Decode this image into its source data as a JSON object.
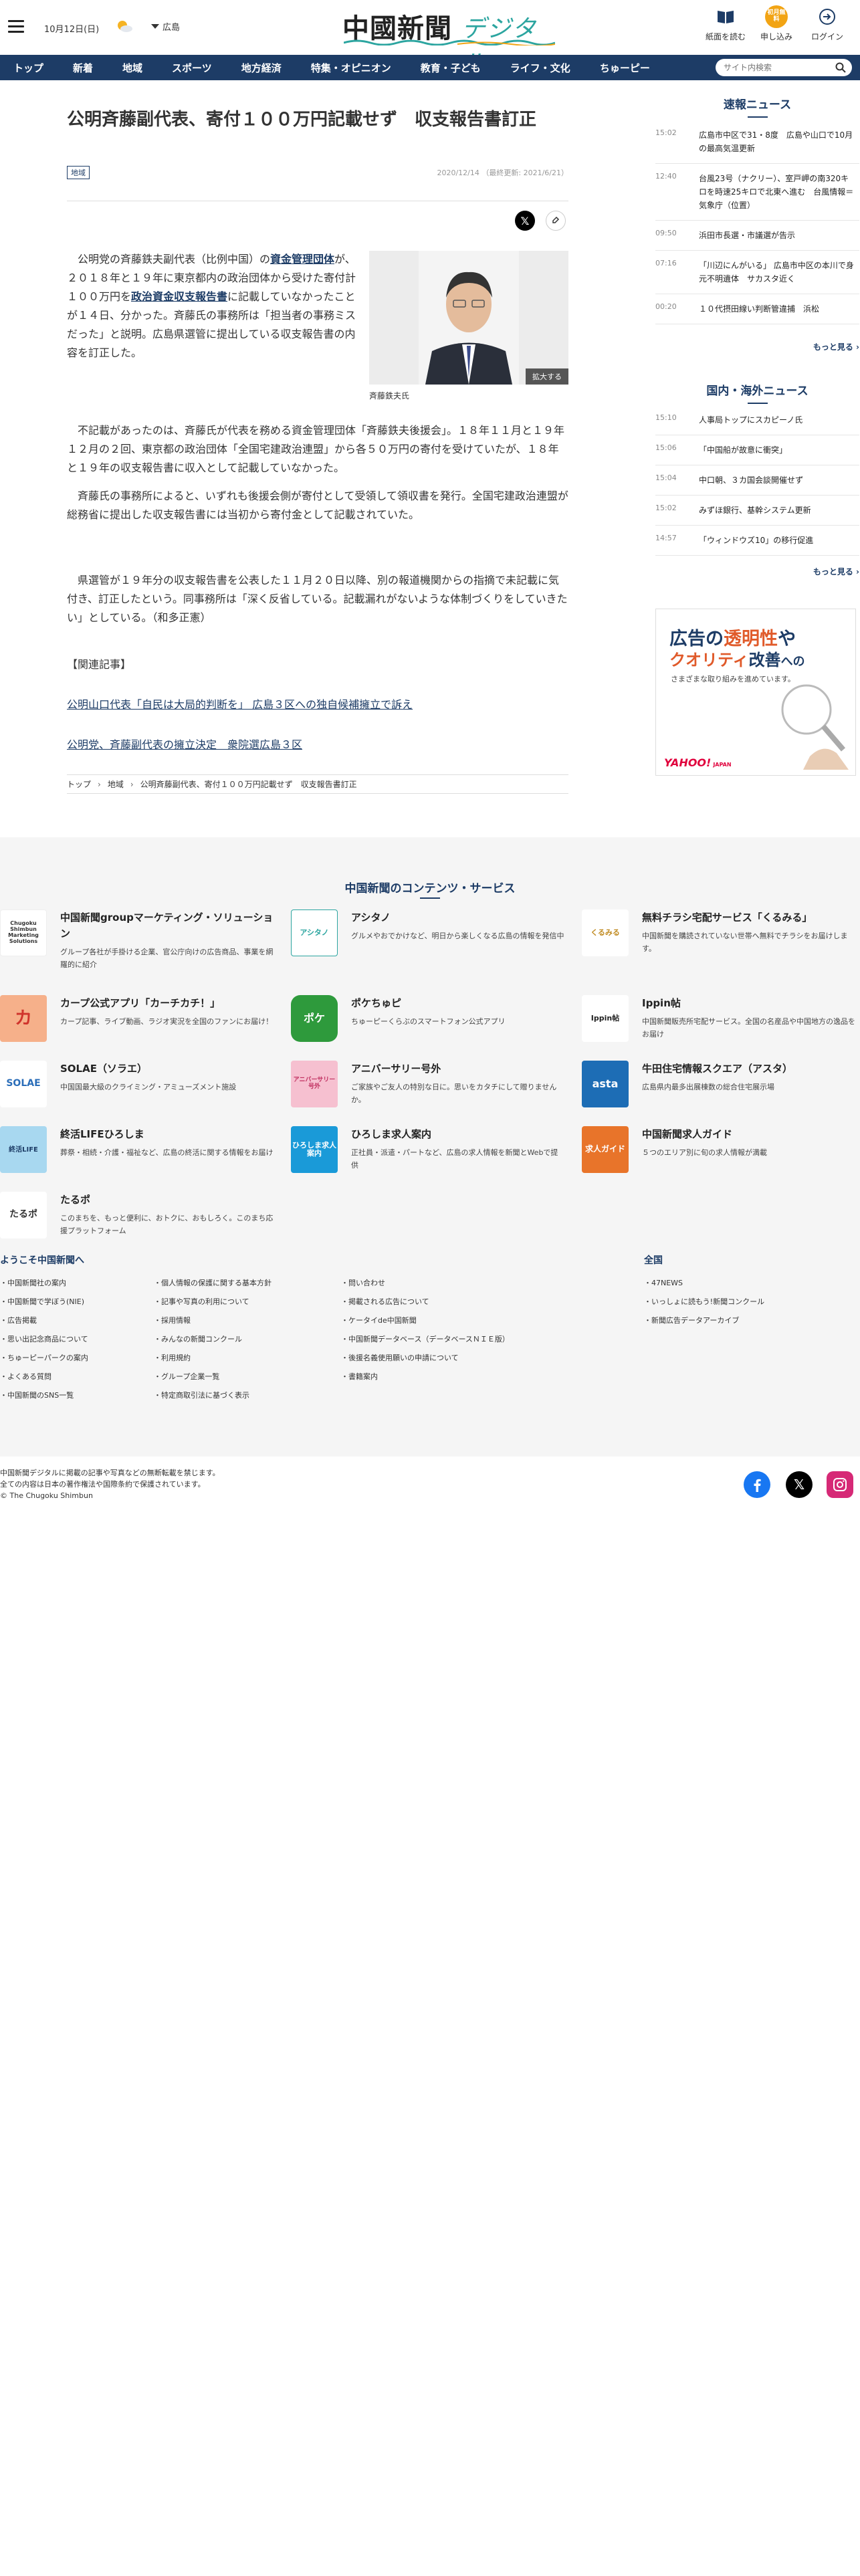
{
  "header": {
    "date": "10月12日(日)",
    "weather_icon": "sun-cloud-icon",
    "region": "広島",
    "logo_main": "中國新聞",
    "logo_sub": "デジタル",
    "buttons": [
      {
        "label": "紙面を読む",
        "icon": "book-icon"
      },
      {
        "label": "申し込み",
        "icon": "subscribe-badge",
        "badge": "初月無料"
      },
      {
        "label": "ログイン",
        "icon": "login-icon"
      }
    ]
  },
  "nav": {
    "items": [
      "トップ",
      "新着",
      "地域",
      "スポーツ",
      "地方経済",
      "特集・オピニオン",
      "教育・子ども",
      "ライフ・文化",
      "ちゅーピー"
    ],
    "search_placeholder": "サイト内検索"
  },
  "article": {
    "title": "公明斉藤副代表、寄付１００万円記載せず　収支報告書訂正",
    "category": "地域",
    "date": "2020/12/14",
    "updated": "（最終更新: 2021/6/21）",
    "p1": {
      "a": "公明党の斉藤鉄夫副代表（比例中国）の",
      "link1": "資金管理団体",
      "b": "が、２０１８年と１９年に東京都内の政治団体から受けた寄付計１００万円を",
      "link2": "政治資金収支報告書",
      "c": "に記載していなかったことが１４日、分かった。斉藤氏の事務所は「担当者の事務ミスだった」と説明。広島県選管に提出している収支報告書の内容を訂正した。"
    },
    "p2": "不記載があったのは、斉藤氏が代表を務める資金管理団体「斉藤鉄夫後援会」。１８年１１月と１９年１２月の２回、東京都の政治団体「全国宅建政治連盟」から各５０万円の寄付を受けていたが、１８年と１９年の収支報告書に収入として記載していなかった。",
    "p3": "斉藤氏の事務所によると、いずれも後援会側が寄付として受領して領収書を発行。全国宅建政治連盟が総務省に提出した収支報告書には当初から寄付金として記載されていた。",
    "p4": "県選管が１９年分の収支報告書を公表した１１月２０日以降、別の報道機関からの指摘で未記載に気付き、訂正したという。同事務所は「深く反省している。記載漏れがないような体制づくりをしていきたい」としている。（和多正憲）",
    "photo_caption": "斉藤鉄夫氏",
    "zoom_label": "拡大する",
    "related_heading": "【関連記事】",
    "related": [
      "公明山口代表「自民は大局的判断を」 広島３区への独自候補擁立で訴え",
      "公明党、斉藤副代表の擁立決定　衆院選広島３区"
    ],
    "breadcrumb": [
      "トップ",
      "地域",
      "公明斉藤副代表、寄付１００万円記載せず　収支報告書訂正"
    ]
  },
  "sidebar": {
    "breaking_title": "速報ニュース",
    "breaking": [
      {
        "time": "15:02",
        "text": "広島市中区で31・8度　広島や山口で10月の最高気温更新"
      },
      {
        "time": "12:40",
        "text": "台風23号（ナクリー）、室戸岬の南320キロを時速25キロで北東へ進む　台風情報＝気象庁（位置）"
      },
      {
        "time": "09:50",
        "text": "浜田市長選・市議選が告示"
      },
      {
        "time": "07:16",
        "text": "「川辺にんがいる」 広島市中区の本川で身元不明遺体　サカスタ近く"
      },
      {
        "time": "00:20",
        "text": "１０代摂田線い判断管違捕　浜松"
      }
    ],
    "more1": "もっと見る",
    "world_title": "国内・海外ニュース",
    "world": [
      {
        "time": "15:10",
        "text": "人事局トップにスカピーノ氏"
      },
      {
        "time": "15:06",
        "text": "「中国船が故意に衝突」"
      },
      {
        "time": "15:04",
        "text": "中口朝、３カ国会談開催せず"
      },
      {
        "time": "15:02",
        "text": "みずほ銀行、基幹システム更新"
      },
      {
        "time": "14:57",
        "text": "「ウィンドウズ10」の移行促進"
      }
    ],
    "more2": "もっと見る",
    "ad": {
      "line1a": "広告の",
      "line1b": "透明性",
      "line1c": "や",
      "line2a": "クオリティ",
      "line2b": "改善",
      "line2c": "への",
      "line3": "さまざまな取り組みを進めています。",
      "brand": "YAHOO!",
      "brand_sub": "JAPAN"
    }
  },
  "services": {
    "title": "中国新聞のコンテンツ・サービス",
    "items": [
      {
        "title": "中国新聞groupマーケティング・ソリューション",
        "desc": "グループ各社が手掛ける企業、官公庁向けの広告商品、事業を網羅的に紹介",
        "thumb": "Chugoku Shimbun Marketing Solutions",
        "color": "#ffffff",
        "fg": "#333333"
      },
      {
        "title": "アシタノ",
        "desc": "グルメやおでかけなど、明日から楽しくなる広島の情報を発信中",
        "thumb": "アシタノ",
        "color": "#ffffff",
        "fg": "#2ca5a0"
      },
      {
        "title": "無料チラシ宅配サービス「くるみる」",
        "desc": "中国新聞を購読されていない世帯へ無料でチラシをお届けします。",
        "thumb": "くるみる",
        "color": "#ffffff",
        "fg": "#c08a20"
      },
      {
        "title": "カープ公式アプリ「カーチカチ！」",
        "desc": "カープ記事、ライブ動画、ラジオ実況を全国のファンにお届け！",
        "thumb": "カ",
        "color": "#f6b08a",
        "fg": "#d0342c"
      },
      {
        "title": "ポケちゅピ",
        "desc": "ちゅーピーくらぶのスマートフォン公式アプリ",
        "thumb": "ポケ",
        "color": "#2e9a3c",
        "fg": "#ffffff"
      },
      {
        "title": "Ippin帖",
        "desc": "中国新聞販売所宅配サービス。全国の名産品や中国地方の逸品をお届け",
        "thumb": "Ippin帖",
        "color": "#ffffff",
        "fg": "#222222"
      },
      {
        "title": "SOLAE（ソラエ）",
        "desc": "中国国最大級のクライミング・アミューズメント施設",
        "thumb": "SOLAE",
        "color": "#ffffff",
        "fg": "#2a6db8"
      },
      {
        "title": "アニバーサリー号外",
        "desc": "ご家族やご友人の特別な日に。思いをカタチにして贈りませんか。",
        "thumb": "アニバーサリー号外",
        "color": "#f6c0d0",
        "fg": "#c03060"
      },
      {
        "title": "牛田住宅情報スクエア（アスタ）",
        "desc": "広島県内最多出展棟数の総合住宅展示場",
        "thumb": "asta",
        "color": "#1d6db5",
        "fg": "#ffffff"
      },
      {
        "title": "終活LIFEひろしま",
        "desc": "葬祭・相続・介護・福祉など、広島の終活に関する情報をお届け",
        "thumb": "終活LIFE",
        "color": "#a8d8f0",
        "fg": "#1d3c66"
      },
      {
        "title": "ひろしま求人案内",
        "desc": "正社員・派遣・パートなど、広島の求人情報を新聞とWebで提供",
        "thumb": "ひろしま求人案内",
        "color": "#1a9ad8",
        "fg": "#ffffff"
      },
      {
        "title": "中国新聞求人ガイド",
        "desc": "５つのエリア別に旬の求人情報が満載",
        "thumb": "求人ガイド",
        "color": "#e8742a",
        "fg": "#ffffff"
      },
      {
        "title": "たるポ",
        "desc": "このまちを、もっと便利に、おトクに、おもしろく。このまち応援プラットフォーム",
        "thumb": "たるポ",
        "color": "#ffffff",
        "fg": "#333333"
      }
    ],
    "welcome_heading": "ようこそ中国新聞へ",
    "col1": [
      "中国新聞社の案内",
      "中国新聞で学ぼう(NIE)",
      "広告掲載",
      "思い出記念商品について",
      "ちゅーピーパークの案内",
      "よくある質問",
      "中国新聞のSNS一覧"
    ],
    "col2": [
      "個人情報の保護に関する基本方針",
      "記事や写真の利用について",
      "採用情報",
      "みんなの新聞コンクール",
      "利用規約",
      "グループ企業一覧",
      "特定商取引法に基づく表示"
    ],
    "col3": [
      "問い合わせ",
      "掲載される広告について",
      "ケータイde中国新聞",
      "中国新聞データベース（データベースＮＩＥ版）",
      "後援名義使用願いの申請について",
      "書籍案内"
    ],
    "national_heading": "全国",
    "col4": [
      "47NEWS",
      "いっしょに読もう!新聞コンクール",
      "新聞広告データアーカイブ"
    ]
  },
  "footer": {
    "line1": "中国新聞デジタルに掲載の記事や写真などの無断転載を禁じます。",
    "line2": "全ての内容は日本の著作権法や国際条約で保護されています。",
    "line3": "© The Chugoku Shimbun"
  },
  "colors": {
    "navy": "#1d3c66",
    "teal": "#2ca5a0",
    "orange": "#f2a414"
  }
}
